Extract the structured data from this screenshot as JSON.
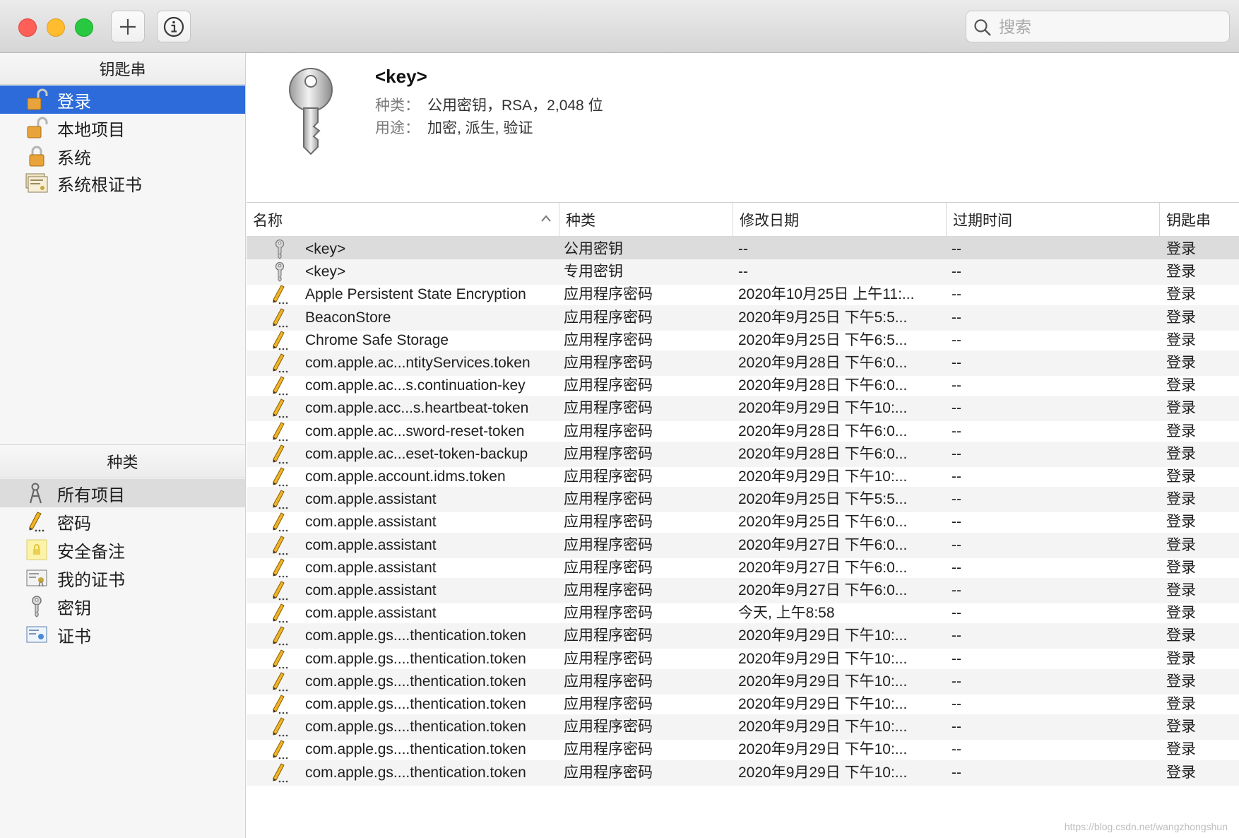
{
  "window": {
    "search_placeholder": "搜索"
  },
  "sidebar": {
    "keychains_header": "钥匙串",
    "keychains": [
      {
        "label": "登录",
        "icon": "unlocked-padlock-icon"
      },
      {
        "label": "本地项目",
        "icon": "unlocked-padlock-icon"
      },
      {
        "label": "系统",
        "icon": "locked-padlock-icon"
      },
      {
        "label": "系统根证书",
        "icon": "certificate-stack-icon"
      }
    ],
    "category_header": "种类",
    "categories": [
      {
        "label": "所有项目",
        "icon": "all-items-icon"
      },
      {
        "label": "密码",
        "icon": "pencil-icon"
      },
      {
        "label": "安全备注",
        "icon": "secure-note-icon"
      },
      {
        "label": "我的证书",
        "icon": "my-certificate-icon"
      },
      {
        "label": "密钥",
        "icon": "key-icon"
      },
      {
        "label": "证书",
        "icon": "certificate-icon"
      }
    ]
  },
  "detail": {
    "title": "<key>",
    "kind_label": "种类：",
    "kind_value": "公用密钥，RSA，2,048 位",
    "usage_label": "用途：",
    "usage_value": "加密, 派生, 验证"
  },
  "table": {
    "columns": [
      "名称",
      "种类",
      "修改日期",
      "过期时间",
      "钥匙串"
    ],
    "rows": [
      {
        "icon": "key",
        "name": "<key>",
        "kind": "公用密钥",
        "date": "--",
        "expires": "--",
        "keychain": "登录"
      },
      {
        "icon": "key",
        "name": "<key>",
        "kind": "专用密钥",
        "date": "--",
        "expires": "--",
        "keychain": "登录"
      },
      {
        "icon": "pencil",
        "name": "Apple Persistent State Encryption",
        "kind": "应用程序密码",
        "date": "2020年10月25日 上午11:...",
        "expires": "--",
        "keychain": "登录"
      },
      {
        "icon": "pencil",
        "name": "BeaconStore",
        "kind": "应用程序密码",
        "date": "2020年9月25日 下午5:5...",
        "expires": "--",
        "keychain": "登录"
      },
      {
        "icon": "pencil",
        "name": "Chrome Safe Storage",
        "kind": "应用程序密码",
        "date": "2020年9月25日 下午6:5...",
        "expires": "--",
        "keychain": "登录"
      },
      {
        "icon": "pencil",
        "name": "com.apple.ac...ntityServices.token",
        "kind": "应用程序密码",
        "date": "2020年9月28日 下午6:0...",
        "expires": "--",
        "keychain": "登录"
      },
      {
        "icon": "pencil",
        "name": "com.apple.ac...s.continuation-key",
        "kind": "应用程序密码",
        "date": "2020年9月28日 下午6:0...",
        "expires": "--",
        "keychain": "登录"
      },
      {
        "icon": "pencil",
        "name": "com.apple.acc...s.heartbeat-token",
        "kind": "应用程序密码",
        "date": "2020年9月29日 下午10:...",
        "expires": "--",
        "keychain": "登录"
      },
      {
        "icon": "pencil",
        "name": "com.apple.ac...sword-reset-token",
        "kind": "应用程序密码",
        "date": "2020年9月28日 下午6:0...",
        "expires": "--",
        "keychain": "登录"
      },
      {
        "icon": "pencil",
        "name": "com.apple.ac...eset-token-backup",
        "kind": "应用程序密码",
        "date": "2020年9月28日 下午6:0...",
        "expires": "--",
        "keychain": "登录"
      },
      {
        "icon": "pencil",
        "name": "com.apple.account.idms.token",
        "kind": "应用程序密码",
        "date": "2020年9月29日 下午10:...",
        "expires": "--",
        "keychain": "登录"
      },
      {
        "icon": "pencil",
        "name": "com.apple.assistant",
        "kind": "应用程序密码",
        "date": "2020年9月25日 下午5:5...",
        "expires": "--",
        "keychain": "登录"
      },
      {
        "icon": "pencil",
        "name": "com.apple.assistant",
        "kind": "应用程序密码",
        "date": "2020年9月25日 下午6:0...",
        "expires": "--",
        "keychain": "登录"
      },
      {
        "icon": "pencil",
        "name": "com.apple.assistant",
        "kind": "应用程序密码",
        "date": "2020年9月27日 下午6:0...",
        "expires": "--",
        "keychain": "登录"
      },
      {
        "icon": "pencil",
        "name": "com.apple.assistant",
        "kind": "应用程序密码",
        "date": "2020年9月27日 下午6:0...",
        "expires": "--",
        "keychain": "登录"
      },
      {
        "icon": "pencil",
        "name": "com.apple.assistant",
        "kind": "应用程序密码",
        "date": "2020年9月27日 下午6:0...",
        "expires": "--",
        "keychain": "登录"
      },
      {
        "icon": "pencil",
        "name": "com.apple.assistant",
        "kind": "应用程序密码",
        "date": "今天, 上午8:58",
        "expires": "--",
        "keychain": "登录"
      },
      {
        "icon": "pencil",
        "name": "com.apple.gs....thentication.token",
        "kind": "应用程序密码",
        "date": "2020年9月29日 下午10:...",
        "expires": "--",
        "keychain": "登录"
      },
      {
        "icon": "pencil",
        "name": "com.apple.gs....thentication.token",
        "kind": "应用程序密码",
        "date": "2020年9月29日 下午10:...",
        "expires": "--",
        "keychain": "登录"
      },
      {
        "icon": "pencil",
        "name": "com.apple.gs....thentication.token",
        "kind": "应用程序密码",
        "date": "2020年9月29日 下午10:...",
        "expires": "--",
        "keychain": "登录"
      },
      {
        "icon": "pencil",
        "name": "com.apple.gs....thentication.token",
        "kind": "应用程序密码",
        "date": "2020年9月29日 下午10:...",
        "expires": "--",
        "keychain": "登录"
      },
      {
        "icon": "pencil",
        "name": "com.apple.gs....thentication.token",
        "kind": "应用程序密码",
        "date": "2020年9月29日 下午10:...",
        "expires": "--",
        "keychain": "登录"
      },
      {
        "icon": "pencil",
        "name": "com.apple.gs....thentication.token",
        "kind": "应用程序密码",
        "date": "2020年9月29日 下午10:...",
        "expires": "--",
        "keychain": "登录"
      },
      {
        "icon": "pencil",
        "name": "com.apple.gs....thentication.token",
        "kind": "应用程序密码",
        "date": "2020年9月29日 下午10:...",
        "expires": "--",
        "keychain": "登录"
      }
    ]
  },
  "watermark": "https://blog.csdn.net/wangzhongshun"
}
